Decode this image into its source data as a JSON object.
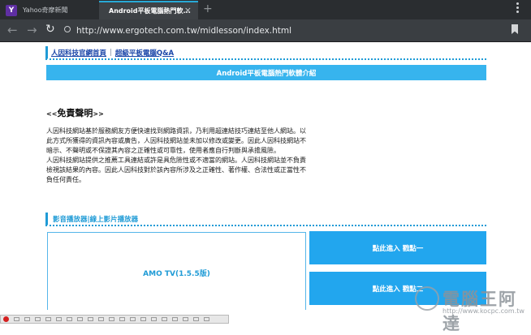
{
  "browser": {
    "tabs": [
      {
        "label": "Yahoo奇摩新聞",
        "active": false,
        "icon": "yahoo-icon",
        "icon_text": "Y"
      },
      {
        "label": "Android平板電腦熱門軟...",
        "active": true
      }
    ],
    "close_glyph": "×",
    "new_tab_glyph": "+",
    "address": {
      "url": "http://www.ergotech.com.tw/midlesson/index.html"
    }
  },
  "page": {
    "breadcrumb": {
      "home": "人因科技官網首頁",
      "separator": "|",
      "current": "超級平板電腦Q&A"
    },
    "banner": "Android平板電腦熱門軟體介紹",
    "disclaimer": {
      "title_open": "<<",
      "title": "免責聲明",
      "title_close": ">>",
      "paragraphs": [
        "人因科技網站基於服務網友方便快速找到網路資訊，乃利用超連結技巧連結至他人網站。以此方式所獲得的資訊內容或廣告，人因科技網站並未加以修改或變更。因此人因科技網站不暗示、不聲明或不保證其內容之正確性或可靠性，使用者應自行判斷與承擔風險。",
        "人因科技網站提供之推薦工具連結或許是具危險性或不適當的網站。人因科技網站並不負責檢視該結果的內容。因此人因科技對於該內容所涉及之正確性、著作權、合法性或正當性不負任何責任。"
      ]
    },
    "player_section": {
      "heading": "影音播放器|線上影片播放器",
      "app_name": "AMO TV(1.5.5版)",
      "button_primary": "點此進入 戳點一",
      "button_secondary": "點此進入 戳點二"
    }
  },
  "watermark": {
    "title": "電腦王阿達",
    "url": "http://www.kocpc.com.tw"
  },
  "colors": {
    "accent": "#1f9bd6",
    "banner": "#37b4ee",
    "button": "#22a6ee",
    "chrome_dark": "#2a2d30"
  }
}
